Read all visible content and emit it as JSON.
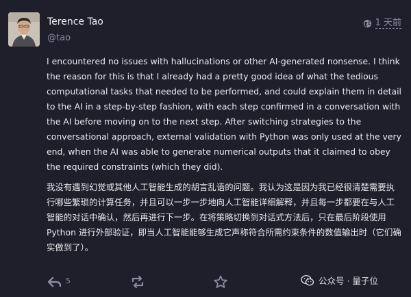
{
  "post": {
    "author_name": "Terence Tao",
    "author_handle": "@tao",
    "time_ago": "1 天前",
    "body_en": "I encountered no issues with hallucinations or other AI-generated nonsense.  I think the reason for this is that I already had a pretty good idea of what the tedious computational tasks that needed to be performed, and could explain them in detail to the AI in a step-by-step fashion, with each step confirmed in a conversation with the AI before moving on to the next step.  After switching strategies to the conversational approach, external validation with Python was only used at the very end, when the AI was able to generate numerical outputs that it claimed to obey the required constraints (which they did).",
    "body_zh": "我没有遇到幻觉或其他人工智能生成的胡言乱语的问题。我认为这是因为我已经很清楚需要执行哪些繁琐的计算任务，并且可以一步一步地向人工智能详细解释，并且每一步都要在与人工智能的对话中确认，然后再进行下一步。在将策略切换到对话式方法后，只在最后阶段使用 Python 进行外部验证，即当人工智能能够生成它声称符合所需约束条件的数值输出时（它们确实做到了）。"
  },
  "actions": {
    "reply_count": "5",
    "reply_icon": "reply-icon",
    "boost_icon": "boost-icon",
    "favourite_icon": "star-icon"
  },
  "visibility_icon": "globe-icon",
  "watermark": {
    "text": "公众号 · 量子位",
    "icon": "wechat-icon"
  },
  "colors": {
    "background": "#1f1f2b",
    "text": "#e9e9ef",
    "muted": "#8a8aa3"
  }
}
